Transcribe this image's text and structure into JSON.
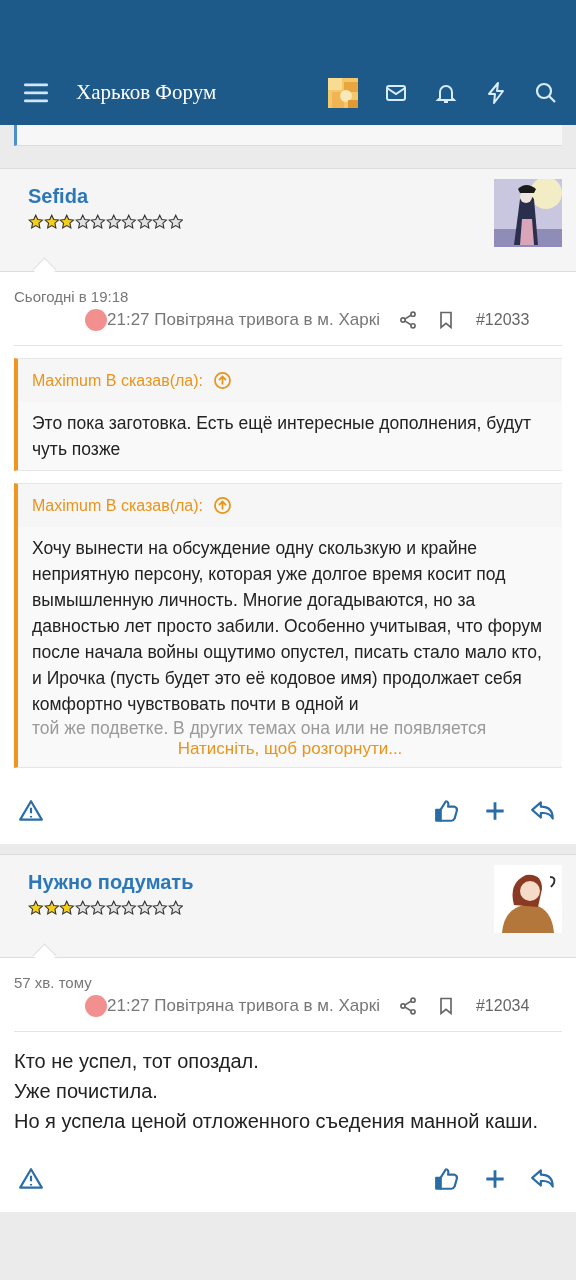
{
  "header": {
    "logo": "Харьков Форум"
  },
  "posts": [
    {
      "author": "Sefida",
      "stars": 3,
      "time": "Сьогодні в 19:18",
      "alert": "21:27 Повітряна тривога в м. Харкі",
      "number": "#12033",
      "quotes": [
        {
          "author": "Maximum B сказав(ла):",
          "text": "Это пока заготовка. Есть ещё интересные дополнения, будут чуть позже"
        },
        {
          "author": "Maximum B сказав(ла):",
          "text": "Хочу вынести на обсуждение одну скользкую и крайне неприятную персону, которая уже долгое время косит под вымышленную личность. Многие догадываются, но за давностью лет просто забили. Особенно учитывая, что форум после начала войны ощутимо опустел, писать стало мало кто, и Ирочка (пусть будет это её кодовое имя) продолжает себя комфортно чувствовать почти в одной и",
          "faded_text": "той же подветке. В других темах она или не появляется",
          "expand": "Натисніть, щоб розгорнути..."
        }
      ]
    },
    {
      "author": "Нужно подумать",
      "stars": 3,
      "time": "57 хв. тому",
      "alert": "21:27 Повітряна тривога в м. Харкі",
      "number": "#12034",
      "lines": [
        "Кто не успел, тот опоздал.",
        "Уже почистила.",
        "Но я успела ценой отложенного съедения манной каши."
      ]
    }
  ]
}
